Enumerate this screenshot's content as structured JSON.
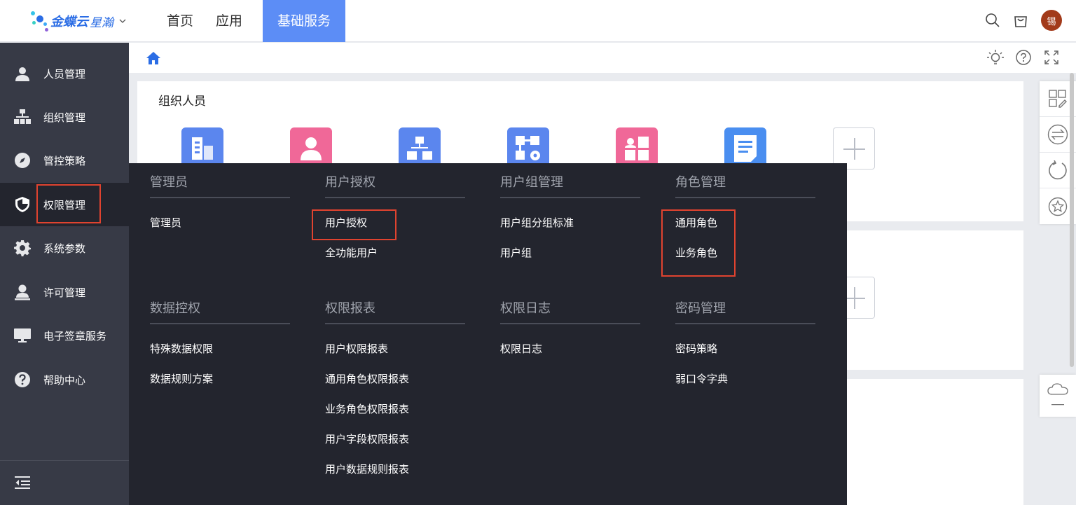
{
  "header": {
    "logo_text": "金蝶云",
    "logo_sub": "星瀚",
    "nav": [
      "首页",
      "应用",
      "基础服务"
    ],
    "avatar_text": "锡"
  },
  "sidebar": {
    "items": [
      {
        "label": "人员管理",
        "icon": "person-icon"
      },
      {
        "label": "组织管理",
        "icon": "org-chart-icon"
      },
      {
        "label": "管控策略",
        "icon": "compass-icon"
      },
      {
        "label": "权限管理",
        "icon": "shield-icon"
      },
      {
        "label": "系统参数",
        "icon": "gear-icon"
      },
      {
        "label": "许可管理",
        "icon": "license-person-icon"
      },
      {
        "label": "电子签章服务",
        "icon": "monitor-icon"
      },
      {
        "label": "帮助中心",
        "icon": "help-icon"
      }
    ]
  },
  "main": {
    "card_title": "组织人员"
  },
  "menu": {
    "groups": [
      {
        "title": "管理员",
        "items": [
          "管理员"
        ]
      },
      {
        "title": "用户授权",
        "items": [
          "用户授权",
          "全功能用户"
        ]
      },
      {
        "title": "用户组管理",
        "items": [
          "用户组分组标准",
          "用户组"
        ]
      },
      {
        "title": "角色管理",
        "items": [
          "通用角色",
          "业务角色"
        ]
      },
      {
        "title": "数据控权",
        "items": [
          "特殊数据权限",
          "数据规则方案"
        ]
      },
      {
        "title": "权限报表",
        "items": [
          "用户权限报表",
          "通用角色权限报表",
          "业务角色权限报表",
          "用户字段权限报表",
          "用户数据规则报表"
        ]
      },
      {
        "title": "权限日志",
        "items": [
          "权限日志"
        ]
      },
      {
        "title": "密码管理",
        "items": [
          "密码策略",
          "弱口令字典"
        ]
      }
    ]
  },
  "colors": {
    "accent": "#5c8df6",
    "sidebar_bg": "#373a46",
    "menu_bg": "#23252e",
    "highlight_red": "#e0432f"
  }
}
